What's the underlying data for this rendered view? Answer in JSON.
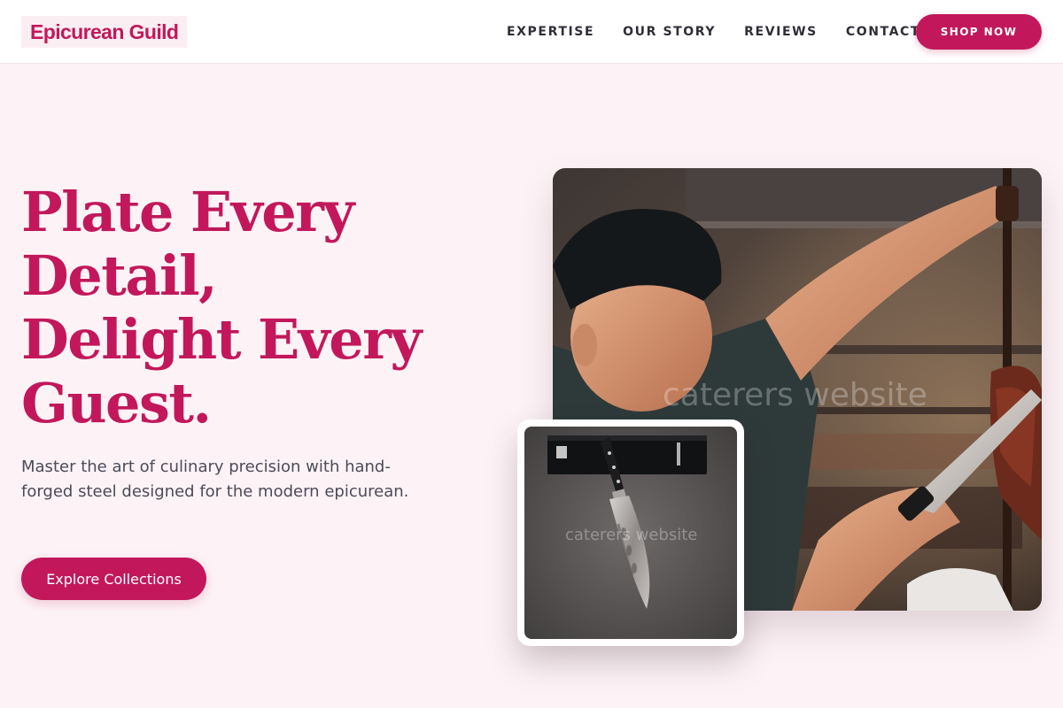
{
  "header": {
    "brand": "Epicurean Guild",
    "nav": [
      "EXPERTISE",
      "OUR STORY",
      "REVIEWS",
      "CONTACT"
    ],
    "shop_button": "SHOP NOW"
  },
  "hero": {
    "headline_lines": [
      "Plate Every",
      "Detail,",
      "Delight Every",
      "Guest."
    ],
    "subtext": "Master the art of culinary precision with hand-forged steel designed for the modern epicurean.",
    "cta": "Explore Collections",
    "main_image": {
      "subject": "chef-slicing-meat-photo",
      "watermark": "caterers website"
    },
    "inset_image": {
      "subject": "knife-product-photo",
      "watermark": "caterers website"
    }
  },
  "colors": {
    "accent": "#c2185b",
    "page_background": "#fdf3f6",
    "header_background": "#ffffff",
    "nav_text": "#2e2e38",
    "body_text": "#4b4b5a"
  }
}
